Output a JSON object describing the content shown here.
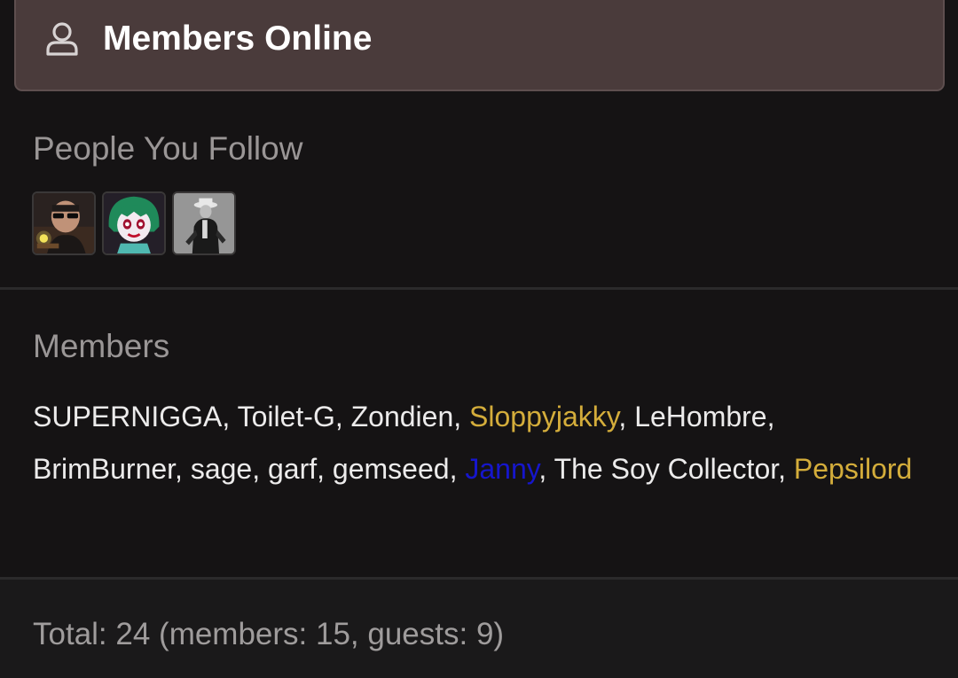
{
  "header": {
    "title": "Members Online",
    "icon": "user-icon"
  },
  "following": {
    "title": "People You Follow",
    "avatars": [
      {
        "icon": "avatar-sunglasses-man"
      },
      {
        "icon": "avatar-green-hair-clown"
      },
      {
        "icon": "avatar-black-white-hat-man"
      }
    ]
  },
  "members": {
    "title": "Members",
    "items": [
      {
        "name": "SUPERNIGGA",
        "sep": ", "
      },
      {
        "name": "Toilet-G",
        "sep": ", "
      },
      {
        "name": "Zondien",
        "sep": ", "
      },
      {
        "name": "Sloppyjakky",
        "sep": ", ",
        "color": "#d4ad3b"
      },
      {
        "name": "LeHombre",
        "sep": ", "
      },
      {
        "name": "BrimBurner",
        "sep": ", "
      },
      {
        "name": "sage",
        "sep": ", "
      },
      {
        "name": "garf",
        "sep": ", "
      },
      {
        "name": "gemseed",
        "sep": ", "
      },
      {
        "name": "Janny",
        "sep": ", ",
        "color": "#1616cc"
      },
      {
        "name": "The Soy Collector",
        "sep": ", "
      },
      {
        "name": "Pepsilord",
        "sep": "",
        "color": "#d4ad3b"
      }
    ]
  },
  "footer": {
    "total": "Total: 24 (members: 15, guests: 9)"
  },
  "colors": {
    "background": "#151314",
    "header_bg": "#4a3b3b",
    "gold_user": "#d4ad3b",
    "blue_user": "#1616cc"
  }
}
